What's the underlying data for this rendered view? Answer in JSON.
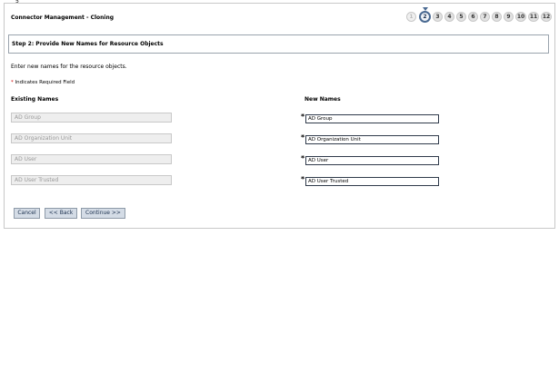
{
  "window": {
    "corner_mark": "5"
  },
  "header": {
    "title": "Connector Management - Cloning"
  },
  "wizard": {
    "steps": [
      "1",
      "2",
      "3",
      "4",
      "5",
      "6",
      "7",
      "8",
      "9",
      "10",
      "11",
      "12"
    ],
    "current_step": "2"
  },
  "step_box": {
    "label": "Step 2: Provide New Names for Resource Objects"
  },
  "instructions": {
    "intro": "Enter new names for the resource objects.",
    "required_star": "*",
    "required_note": "Indicates Required Field"
  },
  "columns": {
    "existing": "Existing Names",
    "new": "New Names"
  },
  "rows": [
    {
      "existing": "AD Group",
      "new": "AD Group"
    },
    {
      "existing": "AD Organization Unit",
      "new": "AD Organization Unit"
    },
    {
      "existing": "AD User",
      "new": "AD User"
    },
    {
      "existing": "AD User Trusted",
      "new": "AD User Trusted"
    }
  ],
  "buttons": {
    "cancel": "Cancel",
    "back": "<< Back",
    "continue": "Continue >>"
  },
  "colors": {
    "accent": "#4a6a92",
    "button_bg": "#d4dce6",
    "required": "#cc0000"
  }
}
